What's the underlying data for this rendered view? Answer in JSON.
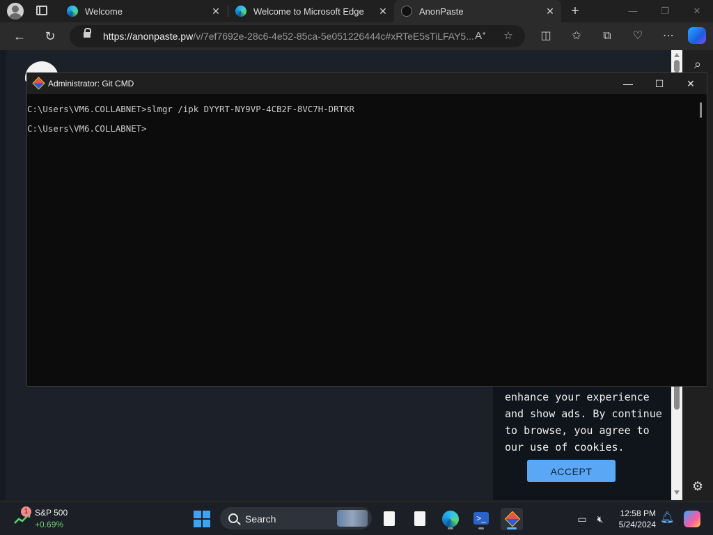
{
  "browser": {
    "tabs": [
      {
        "title": "Welcome",
        "favicon": "edge-icon",
        "active": false
      },
      {
        "title": "Welcome to Microsoft Edge",
        "favicon": "edge-icon",
        "active": false
      },
      {
        "title": "AnonPaste",
        "favicon": "anonpaste-icon",
        "active": true
      }
    ],
    "url_domain": "https://anonpaste.pw",
    "url_path": "/v/7ef7692e-28c6-4e52-85ca-5e051226444c#xRTeE5sTiLFAY5..."
  },
  "page": {
    "cookie_text": "enhance your experience and show ads. By continue to browse, you agree to our use of cookies.",
    "accept_label": "ACCEPT"
  },
  "terminal": {
    "title": "Administrator: Git CMD",
    "lines": [
      "C:\\Users\\VM6.COLLABNET>slmgr /ipk DYYRT-NY9VP-4CB2F-8VC7H-DRTKR",
      "C:\\Users\\VM6.COLLABNET>"
    ]
  },
  "taskbar": {
    "stock_name": "S&P 500",
    "stock_change": "+0.69%",
    "stock_badge": "1",
    "search_label": "Search",
    "time": "12:58 PM",
    "date": "5/24/2024",
    "accent_color": "#5fb2ff"
  }
}
